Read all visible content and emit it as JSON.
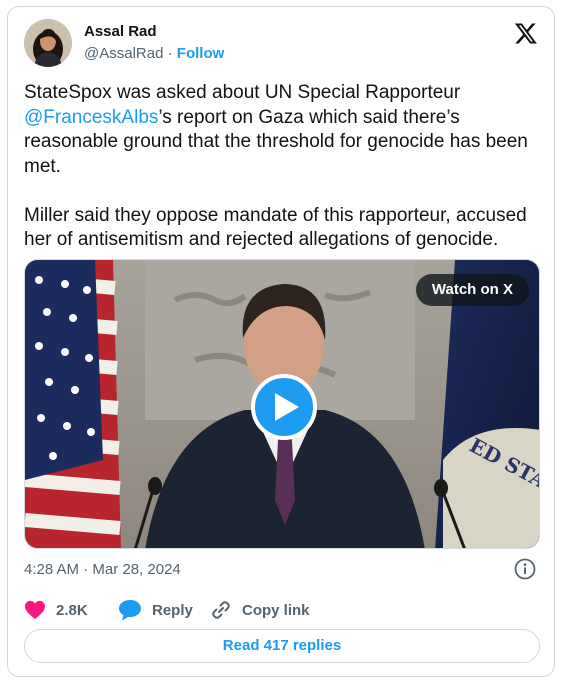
{
  "author": {
    "name": "Assal Rad",
    "handle": "@AssalRad",
    "separator": " · ",
    "follow_label": "Follow"
  },
  "tweet": {
    "text_before_mention": "StateSpox was asked about UN Special Rapporteur\n",
    "mention": "@FranceskAlbs",
    "text_after_mention": "’s report on Gaza which said there’s reasonable ground that the threshold for genocide has been met.\n\nMiller said they oppose mandate of this rapporteur, accused her of antisemitism and rejected allegations of genocide."
  },
  "media": {
    "watch_label": "Watch on X",
    "seal_text": "ED STATES"
  },
  "timestamp": "4:28 AM · Mar 28, 2024",
  "actions": {
    "likes": "2.8K",
    "reply_label": "Reply",
    "copy_link_label": "Copy link"
  },
  "read_replies_label": "Read 417 replies",
  "colors": {
    "accent": "#1d9bf0",
    "like": "#f91880",
    "text": "#0f1419",
    "muted": "#536471",
    "border": "#cfd9de"
  },
  "icons": [
    "x-logo-icon",
    "play-icon",
    "info-icon",
    "heart-icon",
    "reply-bubble-icon",
    "link-icon"
  ]
}
